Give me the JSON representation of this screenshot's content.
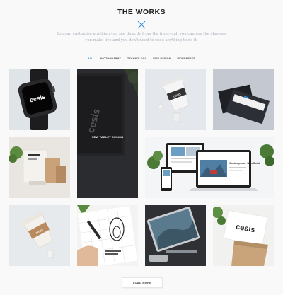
{
  "header": {
    "title": "THE WORKS",
    "close_icon": "close-x-icon",
    "subtitle_line1": "You can customize anything you see directly from the front-end, you can see the changes",
    "subtitle_line2": "you make live and you don't need to code anything to do it."
  },
  "filters": [
    {
      "label": "ALL",
      "active": true
    },
    {
      "label": "PHOTOGRAPHY",
      "active": false
    },
    {
      "label": "TECHNOLOGY",
      "active": false
    },
    {
      "label": "WEB DESIGN",
      "active": false
    },
    {
      "label": "WORDPRESS",
      "active": false
    }
  ],
  "portfolio": {
    "featured_label": "NEW TABLET DESIGN",
    "smartwatch_brand": "cesis",
    "tablet_brand": "cesis",
    "laptop_headline": "Contemporary New Build",
    "bag_brand": "cesis"
  },
  "footer": {
    "load_more_label": "LOAD MORE"
  },
  "colors": {
    "accent": "#2a8fd8",
    "tile_bg": "#e9ecef"
  }
}
